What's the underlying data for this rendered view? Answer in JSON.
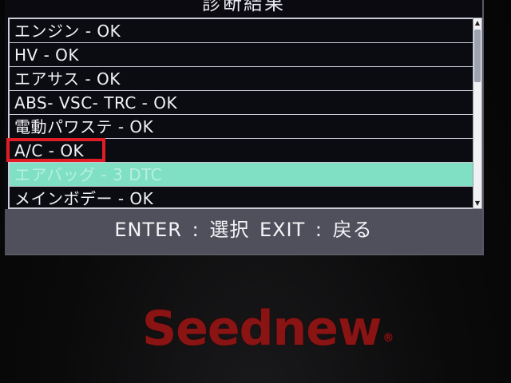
{
  "screen": {
    "title": "診断結果",
    "items": [
      {
        "label": "エンジン - OK"
      },
      {
        "label": "HV - OK"
      },
      {
        "label": "エアサス - OK"
      },
      {
        "label": "ABS- VSC- TRC - OK"
      },
      {
        "label": "電動パワステ - OK"
      },
      {
        "label": "A/C - OK"
      },
      {
        "label": "エアバッグ - 3 DTC"
      },
      {
        "label": "メインボデー - OK"
      }
    ],
    "selected_index": 6,
    "footer": "ENTER : 選択  EXIT : 戻る"
  },
  "device": {
    "brand": "Seednew",
    "registered_mark": "®"
  },
  "icons": {
    "scroll_up": "scroll-up-arrow-icon",
    "scroll_down": "scroll-down-arrow-icon"
  },
  "colors": {
    "selected_row": "#7fe0c4",
    "annotation_box": "#e01d24",
    "brand": "#8a1414"
  }
}
